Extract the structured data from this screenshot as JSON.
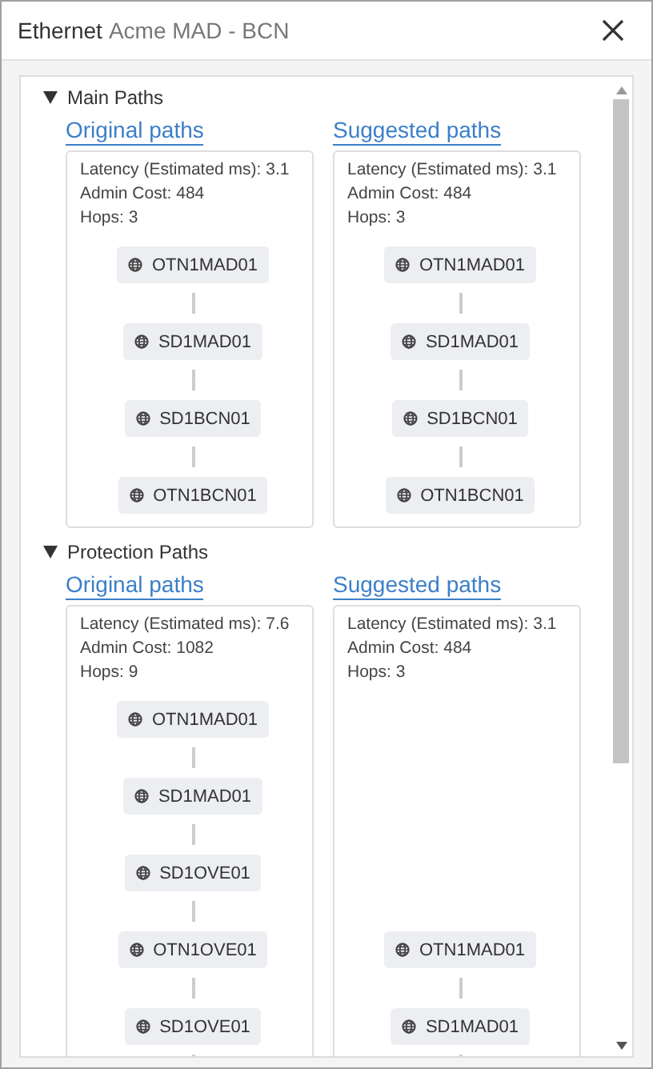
{
  "window": {
    "type_label": "Ethernet",
    "name": "Acme MAD - BCN"
  },
  "sections": [
    {
      "title": "Main Paths",
      "expanded": true,
      "columns": [
        {
          "heading": "Original paths",
          "stats": [
            "Latency (Estimated ms): 3.1",
            "Admin Cost: 484",
            "Hops: 3"
          ],
          "nodes": [
            "OTN1MAD01",
            "SD1MAD01",
            "SD1BCN01",
            "OTN1BCN01"
          ],
          "continues": false
        },
        {
          "heading": "Suggested paths",
          "stats": [
            "Latency (Estimated ms): 3.1",
            "Admin Cost: 484",
            "Hops: 3"
          ],
          "nodes": [
            "OTN1MAD01",
            "SD1MAD01",
            "SD1BCN01",
            "OTN1BCN01"
          ],
          "continues": false
        }
      ]
    },
    {
      "title": "Protection Paths",
      "expanded": true,
      "columns": [
        {
          "heading": "Original paths",
          "stats": [
            "Latency (Estimated ms): 7.6",
            "Admin Cost: 1082",
            "Hops: 9"
          ],
          "nodes": [
            "OTN1MAD01",
            "SD1MAD01",
            "SD1OVE01",
            "OTN1OVE01",
            "SD1OVE01"
          ],
          "continues": true
        },
        {
          "heading": "Suggested paths",
          "stats": [
            "Latency (Estimated ms): 3.1",
            "Admin Cost: 484",
            "Hops: 3"
          ],
          "nodes": [
            "OTN1MAD01",
            "SD1MAD01"
          ],
          "continues": true
        }
      ]
    }
  ]
}
